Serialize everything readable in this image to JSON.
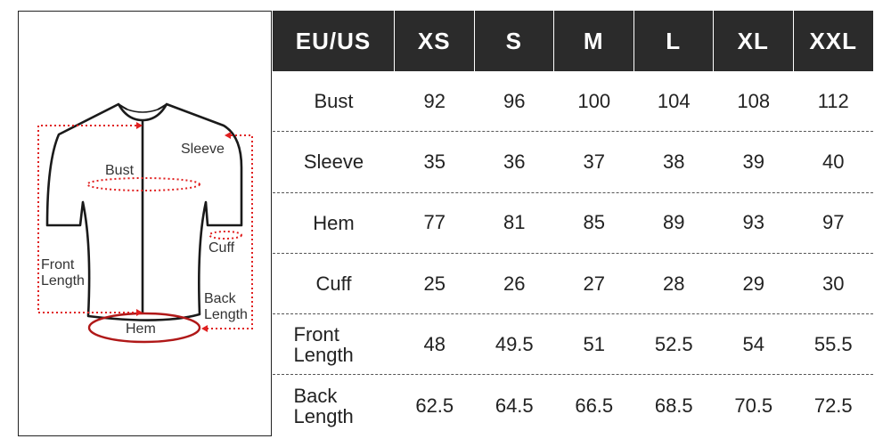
{
  "diagram": {
    "labels": {
      "sleeve": "Sleeve",
      "bust": "Bust",
      "cuff": "Cuff",
      "front_length": "Front Length",
      "back_length": "Back Length",
      "hem": "Hem"
    },
    "accent_color": "#e02020"
  },
  "table": {
    "header": [
      "EU/US",
      "XS",
      "S",
      "M",
      "L",
      "XL",
      "XXL"
    ],
    "rows": [
      {
        "label": "Bust",
        "values": [
          "92",
          "96",
          "100",
          "104",
          "108",
          "112"
        ]
      },
      {
        "label": "Sleeve",
        "values": [
          "35",
          "36",
          "37",
          "38",
          "39",
          "40"
        ]
      },
      {
        "label": "Hem",
        "values": [
          "77",
          "81",
          "85",
          "89",
          "93",
          "97"
        ]
      },
      {
        "label": "Cuff",
        "values": [
          "25",
          "26",
          "27",
          "28",
          "29",
          "30"
        ]
      },
      {
        "label": "Front Length",
        "values": [
          "48",
          "49.5",
          "51",
          "52.5",
          "54",
          "55.5"
        ]
      },
      {
        "label": "Back Length",
        "values": [
          "62.5",
          "64.5",
          "66.5",
          "68.5",
          "70.5",
          "72.5"
        ]
      }
    ]
  }
}
